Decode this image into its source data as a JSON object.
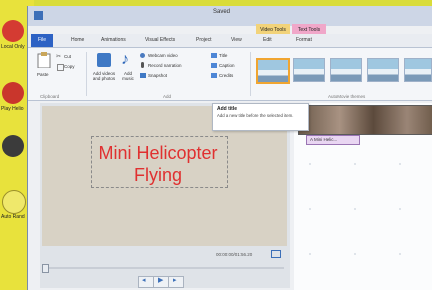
{
  "window": {
    "title": "Saved"
  },
  "context_tabs": {
    "video_tools": "Video Tools",
    "text_tools": "Text Tools"
  },
  "tabs": [
    "File",
    "Home",
    "Animations",
    "Visual Effects",
    "Project",
    "View",
    "Edit",
    "Format"
  ],
  "clipboard": {
    "paste": "Paste",
    "cut": "Cut",
    "copy": "Copy",
    "group": "Clipboard"
  },
  "add_group": {
    "add_videos": "Add videos and photos",
    "add_music": "Add music",
    "webcam": "Webcam video",
    "narration": "Record narration",
    "snapshot": "Snapshot",
    "title": "Title",
    "caption": "Caption",
    "credits": "Credits",
    "group": "Add"
  },
  "themes_group": {
    "label": "AutoMovie themes"
  },
  "tooltip": {
    "title": "Add title",
    "body": "Add a new title before the selected item."
  },
  "preview": {
    "caption_line1": "Mini Helicopter",
    "caption_line2": "Flying",
    "time": "00:00:00/01:56.20"
  },
  "storyboard": {
    "caption_clip": "A Mini Helic..."
  },
  "desktop": {
    "label1": "Local Only",
    "label2": "Play Helio",
    "label3": "Auto Rand"
  },
  "colors": {
    "accent": "#2d62c4",
    "caption_text": "#e03030",
    "context_tab": "#f2d37a"
  }
}
